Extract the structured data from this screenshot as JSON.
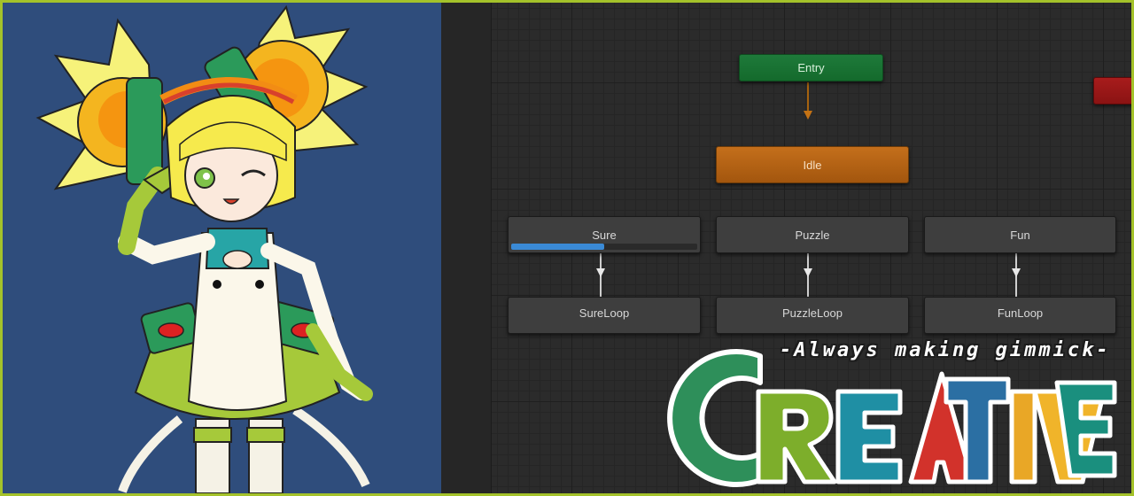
{
  "colors": {
    "frame": "#a4c22a",
    "viewport_bg": "#2f4d7c",
    "entry_state": "#1e7a3a",
    "default_state": "#c46f1b",
    "exit_state": "#a81c1c",
    "state_node": "#3e3e3e",
    "progress": "#3a8ad6"
  },
  "scene_view": {
    "character_icon": "anime-character-saluting-icon"
  },
  "animator": {
    "entry": {
      "label": "Entry"
    },
    "default_state": {
      "label": "Idle"
    },
    "exit": {
      "label": ""
    },
    "states": [
      {
        "label": "Sure",
        "progress": 0.5
      },
      {
        "label": "Puzzle"
      },
      {
        "label": "Fun"
      }
    ],
    "loop_states": [
      {
        "label": "SureLoop"
      },
      {
        "label": "PuzzleLoop"
      },
      {
        "label": "FunLoop"
      }
    ]
  },
  "logo": {
    "tagline": "-Always making gimmick-",
    "wordmark": "CREATIVE"
  }
}
